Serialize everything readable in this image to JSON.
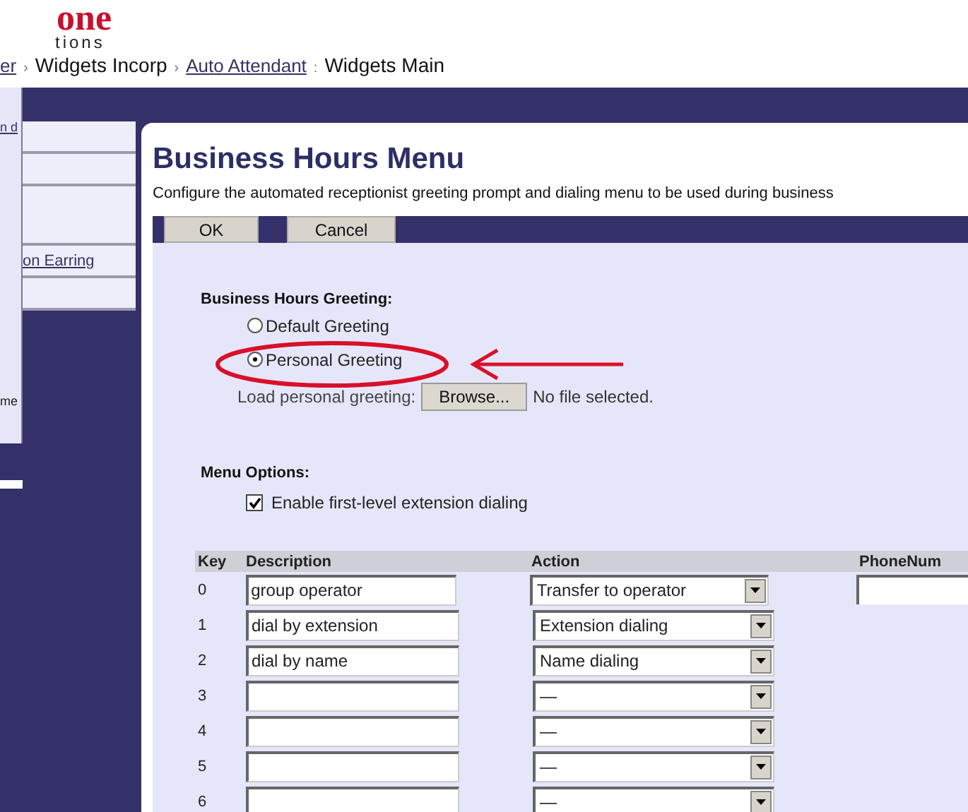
{
  "logo": {
    "top": "one",
    "bottom": "tions"
  },
  "breadcrumb": [
    {
      "kind": "link",
      "text": "er"
    },
    {
      "kind": "sep",
      "text": "›"
    },
    {
      "kind": "text",
      "text": "Widgets Incorp"
    },
    {
      "kind": "sep",
      "text": "›"
    },
    {
      "kind": "link",
      "text": "Auto Attendant"
    },
    {
      "kind": "sep",
      "text": ":"
    },
    {
      "kind": "text",
      "text": "Widgets Main"
    }
  ],
  "sidebar": {
    "strip": [
      {
        "kind": "link",
        "text": "n d"
      },
      {
        "kind": "text",
        "text": "me"
      }
    ],
    "nav_link": "on Earring"
  },
  "title": "Business Hours Menu",
  "description": "Configure the automated receptionist greeting prompt and dialing menu to be used during business",
  "buttons": [
    "OK",
    "Cancel"
  ],
  "greeting": {
    "heading": "Business Hours Greeting:",
    "options": [
      {
        "label": "Default Greeting",
        "selected": false
      },
      {
        "label": "Personal Greeting",
        "selected": true
      }
    ],
    "load_label": "Load personal greeting:",
    "browse_button": "Browse...",
    "file_status": "No file selected."
  },
  "menu_options": {
    "heading": "Menu Options:",
    "checkbox": {
      "label": "Enable first-level extension dialing",
      "checked": true
    }
  },
  "table": {
    "columns": [
      "Key",
      "Description",
      "Action",
      "PhoneNum"
    ],
    "rows": [
      {
        "key": "0",
        "description": "group operator",
        "action": "Transfer to operator",
        "phone_field": true
      },
      {
        "key": "1",
        "description": "dial by extension",
        "action": "Extension dialing",
        "phone_field": false
      },
      {
        "key": "2",
        "description": "dial by name",
        "action": "Name dialing",
        "phone_field": false
      },
      {
        "key": "3",
        "action": "—",
        "phone_field": false
      },
      {
        "key": "4",
        "action": "—",
        "phone_field": false
      },
      {
        "key": "5",
        "action": "—",
        "phone_field": false
      },
      {
        "key": "6",
        "action": "—",
        "phone_field": false
      }
    ]
  }
}
